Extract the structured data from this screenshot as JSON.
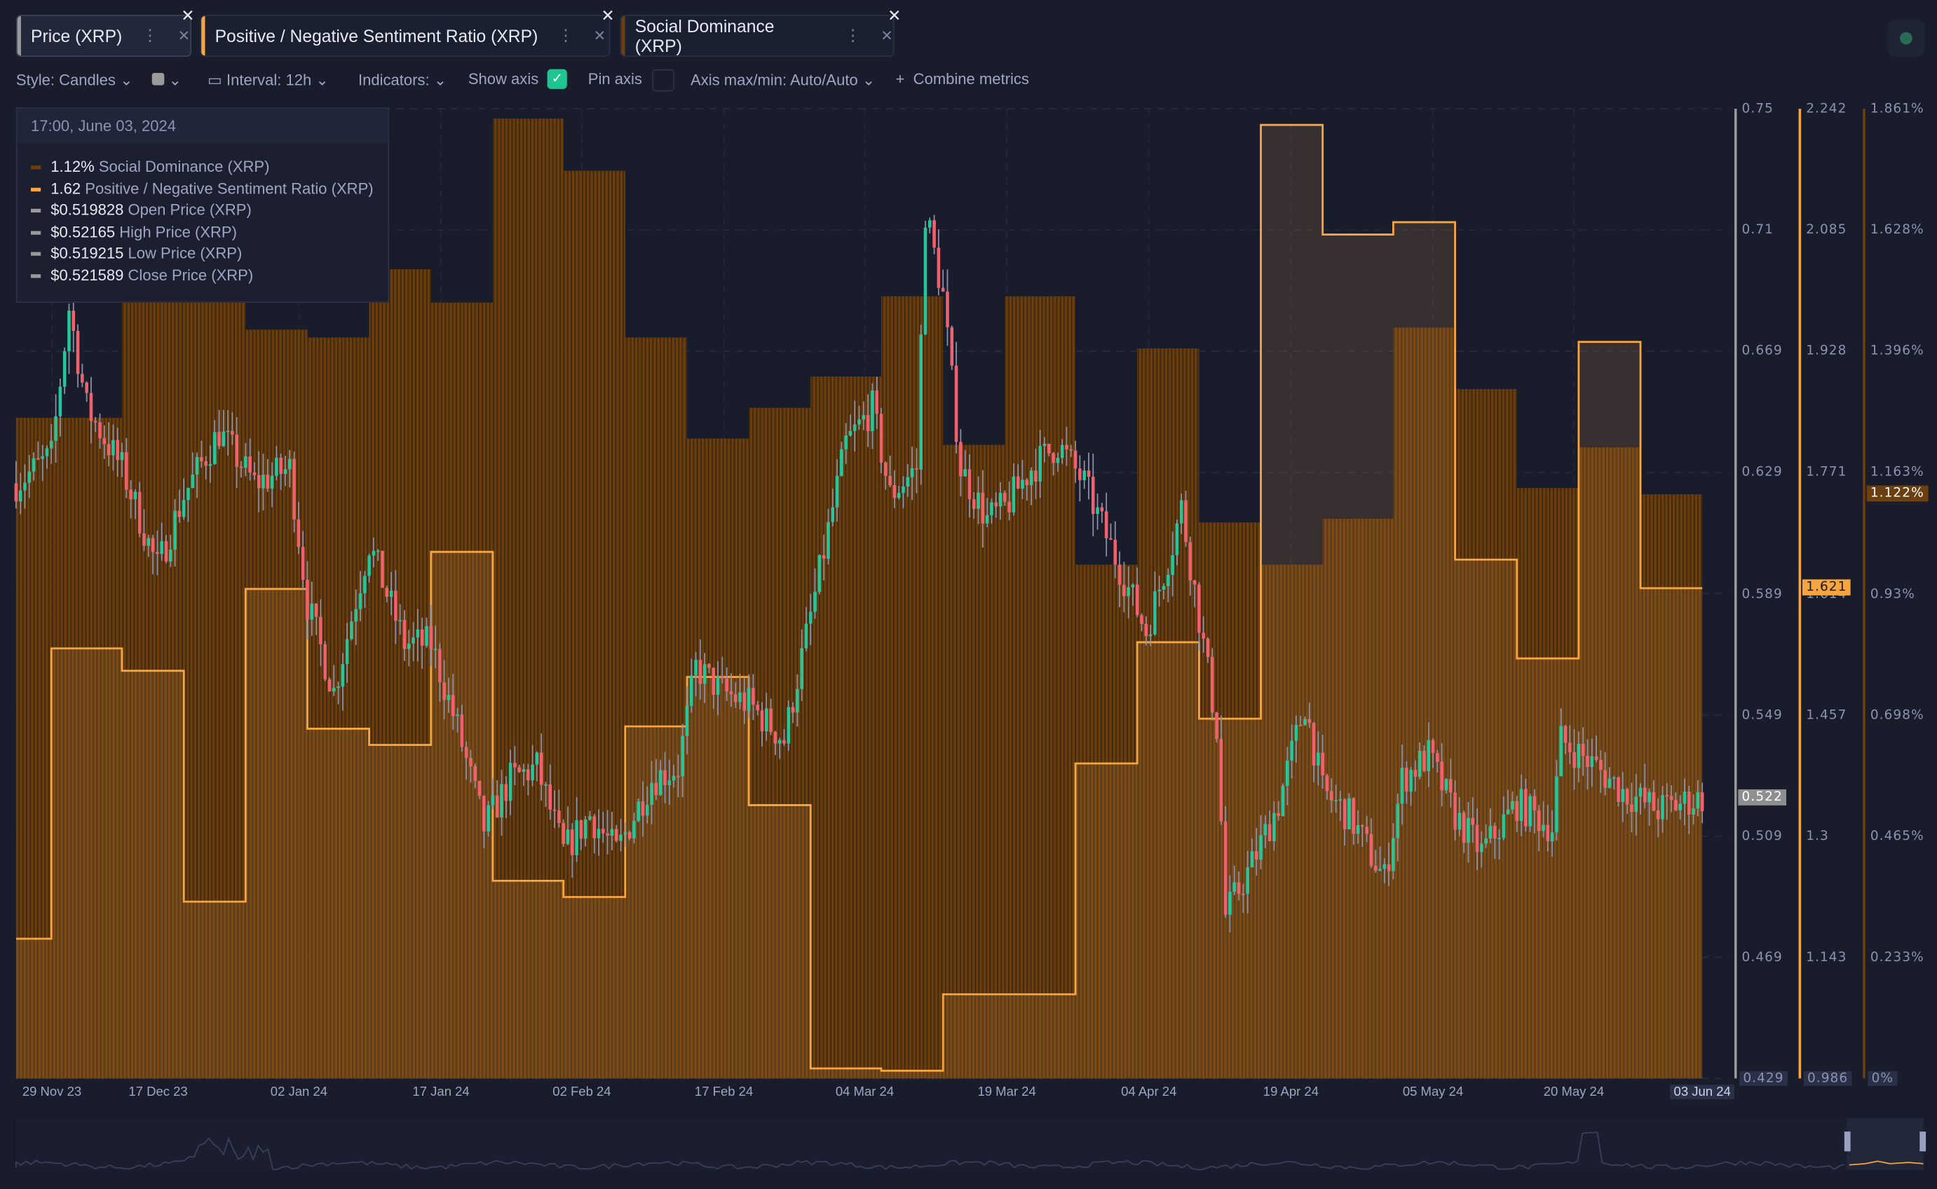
{
  "tabs": [
    {
      "label": "Price (XRP)",
      "color": "#9a9a9a"
    },
    {
      "label": "Positive / Negative Sentiment Ratio (XRP)",
      "color": "#f7a540"
    },
    {
      "label": "Social Dominance (XRP)",
      "color": "#6b3f0f"
    }
  ],
  "toolbar": {
    "style": "Style: Candles",
    "interval": "Interval: 12h",
    "indicators": "Indicators:",
    "show_axis": "Show axis",
    "show_axis_checked": true,
    "pin_axis": "Pin axis",
    "pin_axis_checked": false,
    "axis_minmax": "Axis max/min: Auto/Auto",
    "combine": "Combine metrics",
    "check_color": "#1fc590"
  },
  "tooltip": {
    "date": "17:00, June 03, 2024",
    "rows": [
      {
        "value": "1.12%",
        "label": "Social Dominance (XRP)",
        "color": "#6b3f0f"
      },
      {
        "value": "1.62",
        "label": "Positive / Negative Sentiment Ratio (XRP)",
        "color": "#f7a540"
      },
      {
        "value": "$0.519828",
        "label": "Open Price (XRP)",
        "color": "#9a9a9a"
      },
      {
        "value": "$0.52165",
        "label": "High Price (XRP)",
        "color": "#9a9a9a"
      },
      {
        "value": "$0.519215",
        "label": "Low Price (XRP)",
        "color": "#9a9a9a"
      },
      {
        "value": "$0.521589",
        "label": "Close Price (XRP)",
        "color": "#9a9a9a"
      }
    ]
  },
  "chart_data": {
    "type": "candlestick+step+bar",
    "x_range": [
      "2023-11-25",
      "2024-06-03"
    ],
    "x_ticks": [
      "29 Nov 23",
      "17 Dec 23",
      "02 Jan 24",
      "17 Jan 24",
      "02 Feb 24",
      "17 Feb 24",
      "04 Mar 24",
      "19 Mar 24",
      "04 Apr 24",
      "19 Apr 24",
      "05 May 24",
      "20 May 24",
      "03 Jun 24"
    ],
    "axes": {
      "price": {
        "ticks": [
          "0.75",
          "0.71",
          "0.669",
          "0.629",
          "0.589",
          "0.549",
          "0.509",
          "0.469",
          "0.429"
        ],
        "ylim": [
          0.429,
          0.75
        ],
        "current": "0.522",
        "color": "#9a9a9a"
      },
      "sentiment": {
        "ticks": [
          "2.242",
          "2.085",
          "1.928",
          "1.771",
          "1.614",
          "1.457",
          "1.3",
          "1.143",
          "0.986"
        ],
        "ylim": [
          0.986,
          2.242
        ],
        "current": "1.621",
        "color": "#f7a540"
      },
      "dominance": {
        "ticks": [
          "1.861%",
          "1.628%",
          "1.396%",
          "1.163%",
          "0.93%",
          "0.698%",
          "0.465%",
          "0.233%",
          "0%"
        ],
        "ylim": [
          0,
          1.861
        ],
        "current": "1.122%",
        "color": "#6b3f0f"
      }
    },
    "colors": {
      "up": "#26c69a",
      "down": "#f0616d",
      "wick": "#8d91a8",
      "bar_fill": "#6a3d0c",
      "sentiment_line": "#f7a540"
    },
    "price_close": [
      [
        "2023-11-25",
        0.626
      ],
      [
        "2023-11-29",
        0.635
      ],
      [
        "2023-12-01",
        0.684
      ],
      [
        "2023-12-03",
        0.651
      ],
      [
        "2023-12-07",
        0.631
      ],
      [
        "2023-12-11",
        0.598
      ],
      [
        "2023-12-14",
        0.622
      ],
      [
        "2023-12-18",
        0.643
      ],
      [
        "2023-12-22",
        0.626
      ],
      [
        "2023-12-26",
        0.631
      ],
      [
        "2023-12-28",
        0.586
      ],
      [
        "2023-12-31",
        0.557
      ],
      [
        "2024-01-04",
        0.606
      ],
      [
        "2024-01-08",
        0.573
      ],
      [
        "2024-01-11",
        0.573
      ],
      [
        "2024-01-14",
        0.545
      ],
      [
        "2024-01-17",
        0.512
      ],
      [
        "2024-01-20",
        0.528
      ],
      [
        "2024-01-23",
        0.532
      ],
      [
        "2024-01-26",
        0.504
      ],
      [
        "2024-01-29",
        0.516
      ],
      [
        "2024-02-01",
        0.504
      ],
      [
        "2024-02-05",
        0.528
      ],
      [
        "2024-02-08",
        0.532
      ],
      [
        "2024-02-10",
        0.565
      ],
      [
        "2024-02-13",
        0.557
      ],
      [
        "2024-02-16",
        0.553
      ],
      [
        "2024-02-20",
        0.541
      ],
      [
        "2024-02-23",
        0.582
      ],
      [
        "2024-02-27",
        0.639
      ],
      [
        "2024-03-01",
        0.651
      ],
      [
        "2024-03-03",
        0.622
      ],
      [
        "2024-03-06",
        0.631
      ],
      [
        "2024-03-07",
        0.716
      ],
      [
        "2024-03-09",
        0.688
      ],
      [
        "2024-03-11",
        0.631
      ],
      [
        "2024-03-14",
        0.614
      ],
      [
        "2024-03-16",
        0.618
      ],
      [
        "2024-03-19",
        0.631
      ],
      [
        "2024-03-22",
        0.639
      ],
      [
        "2024-03-25",
        0.626
      ],
      [
        "2024-03-29",
        0.598
      ],
      [
        "2024-04-01",
        0.577
      ],
      [
        "2024-04-04",
        0.606
      ],
      [
        "2024-04-05",
        0.618
      ],
      [
        "2024-04-09",
        0.545
      ],
      [
        "2024-04-10",
        0.483
      ],
      [
        "2024-04-13",
        0.5
      ],
      [
        "2024-04-16",
        0.52
      ],
      [
        "2024-04-19",
        0.553
      ],
      [
        "2024-04-21",
        0.524
      ],
      [
        "2024-04-24",
        0.516
      ],
      [
        "2024-04-28",
        0.495
      ],
      [
        "2024-04-30",
        0.528
      ],
      [
        "2024-05-03",
        0.536
      ],
      [
        "2024-05-06",
        0.516
      ],
      [
        "2024-05-09",
        0.504
      ],
      [
        "2024-05-13",
        0.52
      ],
      [
        "2024-05-17",
        0.512
      ],
      [
        "2024-05-18",
        0.541
      ],
      [
        "2024-05-22",
        0.532
      ],
      [
        "2024-05-25",
        0.524
      ],
      [
        "2024-05-29",
        0.518
      ],
      [
        "2024-06-03",
        0.522
      ]
    ],
    "step_dates": [
      "2023-11-25",
      "2023-11-29",
      "2023-12-07",
      "2023-12-14",
      "2023-12-21",
      "2023-12-28",
      "2024-01-04",
      "2024-01-11",
      "2024-01-18",
      "2024-01-26",
      "2024-02-02",
      "2024-02-09",
      "2024-02-16",
      "2024-02-23",
      "2024-03-02",
      "2024-03-09",
      "2024-03-16",
      "2024-03-24",
      "2024-03-31",
      "2024-04-07",
      "2024-04-14",
      "2024-04-21",
      "2024-04-29",
      "2024-05-06",
      "2024-05-13",
      "2024-05-20",
      "2024-05-27"
    ],
    "sentiment_ratio": [
      1.167,
      1.543,
      1.514,
      1.215,
      1.62,
      1.439,
      1.418,
      1.668,
      1.242,
      1.221,
      1.442,
      1.506,
      1.34,
      0.999,
      0.996,
      1.095,
      1.095,
      1.394,
      1.551,
      1.452,
      2.221,
      2.079,
      2.095,
      1.658,
      1.53,
      1.94,
      1.621
    ],
    "social_dominance": [
      1.268,
      1.268,
      1.56,
      1.56,
      1.437,
      1.422,
      1.553,
      1.489,
      1.842,
      1.742,
      1.422,
      1.228,
      1.287,
      1.347,
      1.501,
      1.216,
      1.501,
      0.986,
      1.401,
      1.067,
      0.986,
      1.074,
      1.441,
      1.323,
      1.133,
      1.211,
      1.121
    ]
  }
}
